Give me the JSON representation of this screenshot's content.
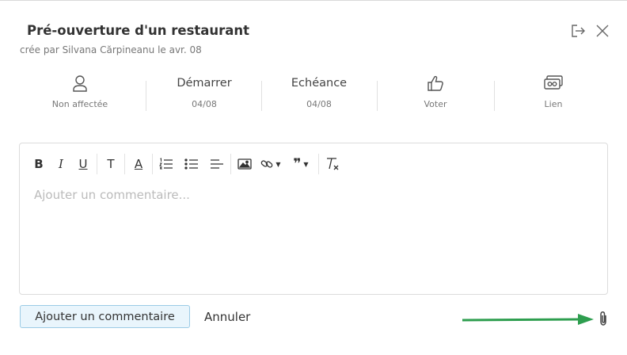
{
  "task": {
    "title": "Pré-ouverture d'un restaurant",
    "subtitle": "crée par Silvana Cărpineanu le avr. 08"
  },
  "header_actions": [
    {
      "icon": "exit-icon"
    },
    {
      "icon": "close-icon"
    }
  ],
  "stats": {
    "assignee": {
      "icon": "user-icon",
      "label": "Non affectée"
    },
    "start": {
      "title": "Démarrer",
      "date": "04/08"
    },
    "due": {
      "title": "Echéance",
      "date": "04/08"
    },
    "vote": {
      "icon": "thumbs-up-icon",
      "label": "Voter"
    },
    "link": {
      "icon": "link-icon",
      "label": "Lien"
    }
  },
  "toolbar": {
    "bold": "B",
    "italic": "I",
    "underline": "U",
    "text_style": "T",
    "font_color": "A",
    "quote": "❞"
  },
  "comment": {
    "placeholder": "Ajouter un commentaire..."
  },
  "actions": {
    "submit_label": "Ajouter un commentaire",
    "cancel_label": "Annuler"
  },
  "colors": {
    "annotation_arrow": "#2e9e4f",
    "primary_button_bg": "#e9f5fc",
    "primary_button_border": "#9bcbe6"
  }
}
